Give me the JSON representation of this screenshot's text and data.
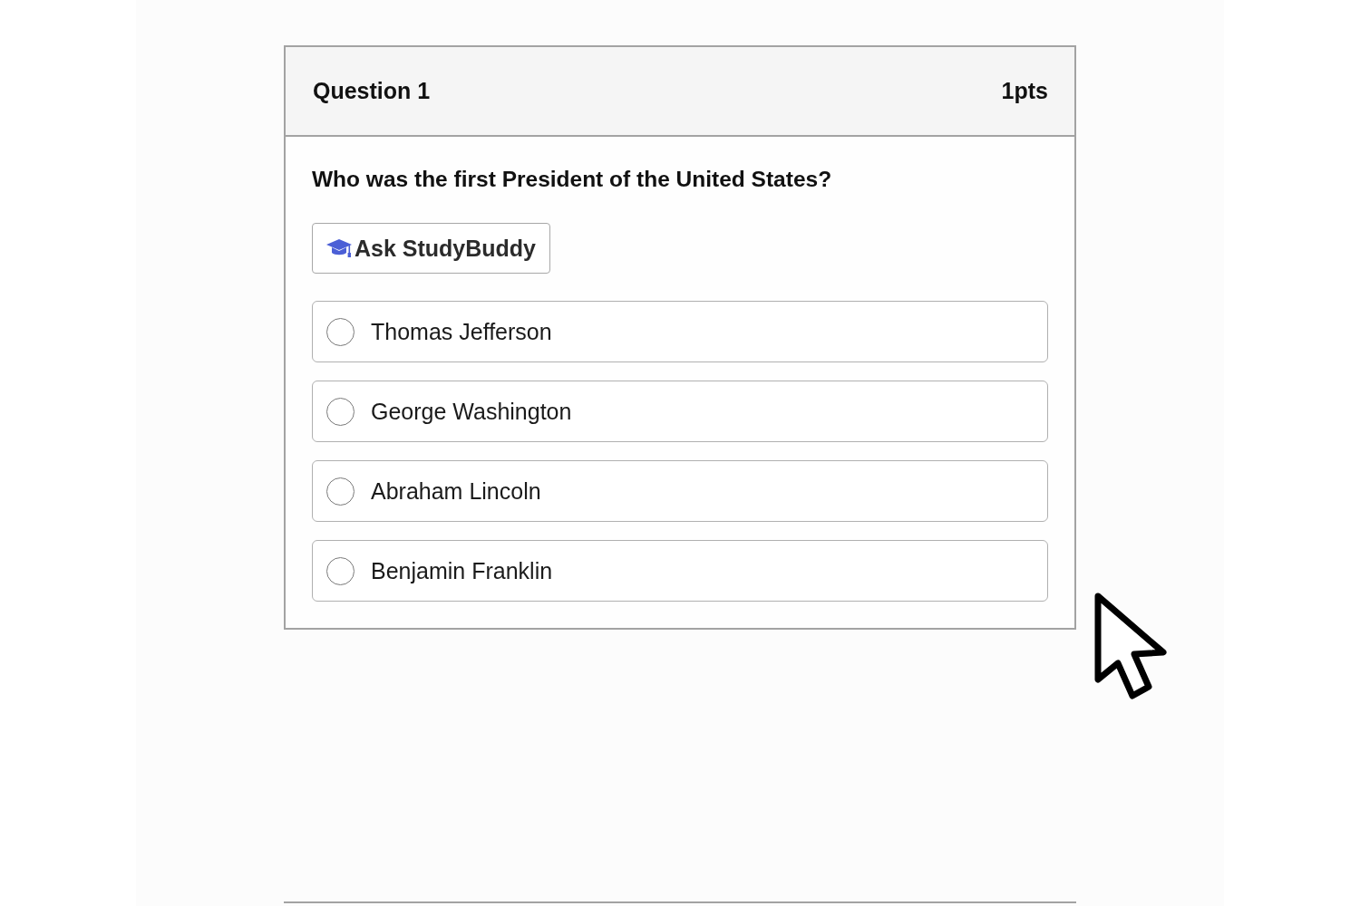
{
  "question": {
    "title": "Question 1",
    "points": "1pts",
    "prompt": "Who was the first President of the United States?",
    "help_button": {
      "label": "Ask StudyBuddy"
    },
    "options": [
      {
        "label": "Thomas Jefferson",
        "selected": false
      },
      {
        "label": "George Washington",
        "selected": false
      },
      {
        "label": "Abraham Lincoln",
        "selected": false
      },
      {
        "label": "Benjamin Franklin",
        "selected": false
      }
    ]
  }
}
